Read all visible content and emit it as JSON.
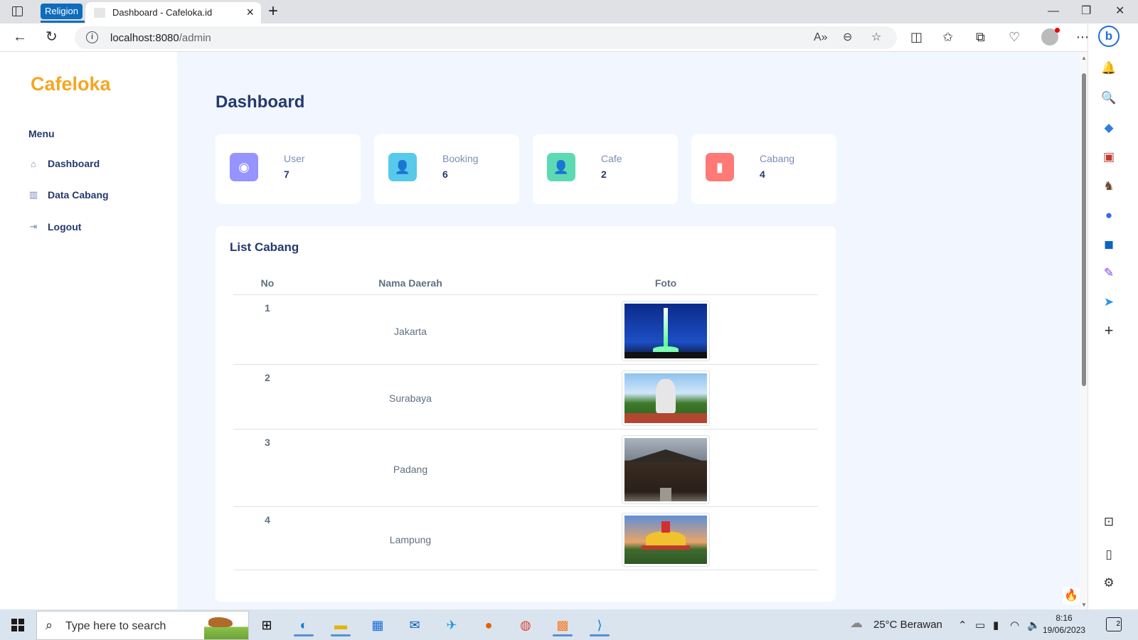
{
  "browser": {
    "tab_group_label": "Religion",
    "tab_title": "Dashboard - Cafeloka.id",
    "url_host": "localhost:8080",
    "url_path": "/admin"
  },
  "sidebar": {
    "brand": "Cafeloka",
    "menu_title": "Menu",
    "items": [
      {
        "label": "Dashboard",
        "icon": "home-icon"
      },
      {
        "label": "Data Cabang",
        "icon": "bar-chart-icon"
      },
      {
        "label": "Logout",
        "icon": "logout-icon"
      }
    ]
  },
  "main": {
    "title": "Dashboard",
    "stats": [
      {
        "label": "User",
        "value": "7",
        "icon": "eye-icon",
        "color": "#9694ff"
      },
      {
        "label": "Booking",
        "value": "6",
        "icon": "user-icon",
        "color": "#57caeb"
      },
      {
        "label": "Cafe",
        "value": "2",
        "icon": "user-plus-icon",
        "color": "#5ddab4"
      },
      {
        "label": "Cabang",
        "value": "4",
        "icon": "bookmark-icon",
        "color": "#ff7976"
      }
    ],
    "list": {
      "title": "List Cabang",
      "headers": [
        "No",
        "Nama Daerah",
        "Foto"
      ],
      "rows": [
        {
          "no": "1",
          "name": "Jakarta",
          "photo": "monas-photo"
        },
        {
          "no": "2",
          "name": "Surabaya",
          "photo": "suro-boyo-monument-photo"
        },
        {
          "no": "3",
          "name": "Padang",
          "photo": "rumah-gadang-photo"
        },
        {
          "no": "4",
          "name": "Lampung",
          "photo": "menara-siger-photo"
        }
      ]
    }
  },
  "taskbar": {
    "search_placeholder": "Type here to search",
    "weather": "25°C  Berawan",
    "time": "8:16",
    "date": "19/06/2023",
    "notification_count": "2"
  }
}
